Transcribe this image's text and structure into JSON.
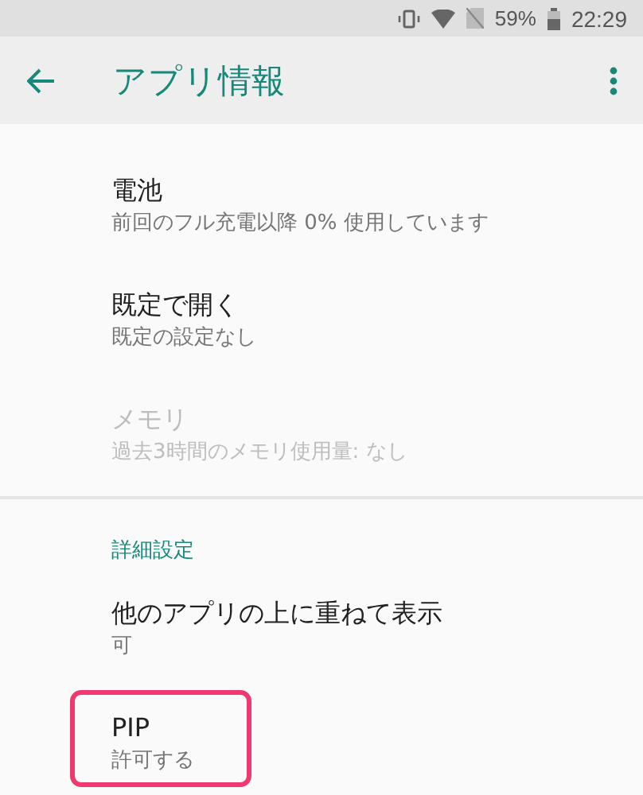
{
  "status_bar": {
    "battery": "59%",
    "time": "22:29"
  },
  "toolbar": {
    "title": "アプリ情報"
  },
  "items": [
    {
      "kind": "setting",
      "title": "電池",
      "summary": "前回のフル充電以降 0% 使用しています",
      "disabled": false,
      "highlighted": false
    },
    {
      "kind": "setting",
      "title": "既定で開く",
      "summary": "既定の設定なし",
      "disabled": false,
      "highlighted": false
    },
    {
      "kind": "setting",
      "title": "メモリ",
      "summary": "過去3時間のメモリ使用量: なし",
      "disabled": true,
      "highlighted": false
    },
    {
      "kind": "divider"
    },
    {
      "kind": "header",
      "title": "詳細設定"
    },
    {
      "kind": "setting",
      "title": "他のアプリの上に重ねて表示",
      "summary": "可",
      "disabled": false,
      "highlighted": false
    },
    {
      "kind": "setting",
      "title": "PIP",
      "summary": "許可する",
      "disabled": false,
      "highlighted": true
    }
  ]
}
